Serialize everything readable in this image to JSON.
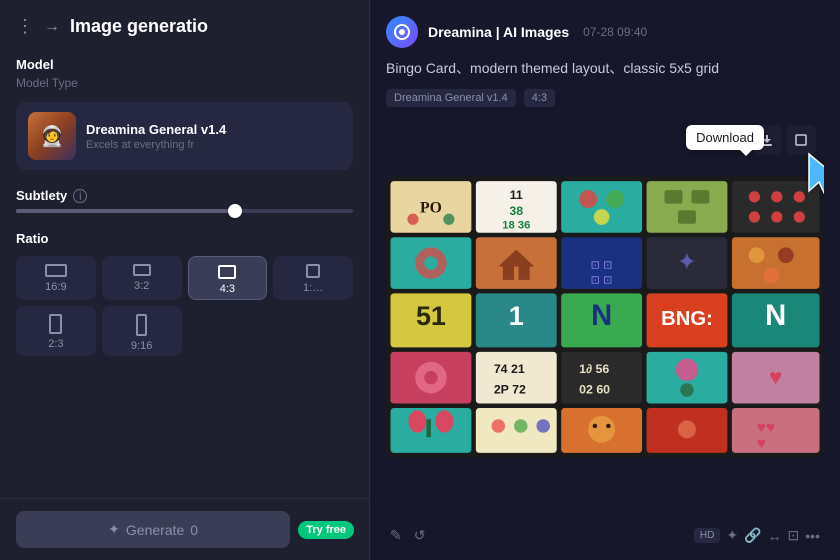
{
  "left": {
    "menu_icon": "⋮",
    "arrow": "→",
    "title": "Image generatio",
    "model_section": "Model",
    "model_type": "Model Type",
    "model_thumb_emoji": "🧑‍🚀",
    "model_name": "Dreamina General v1.4",
    "model_desc": "Excels at everything fr",
    "subtlety_label": "Subtlety",
    "ratio_label": "Ratio",
    "ratios_row1": [
      {
        "label": "16:9",
        "active": false
      },
      {
        "label": "3:2",
        "active": false
      },
      {
        "label": "4:3",
        "active": true
      },
      {
        "label": "1:…",
        "active": false
      }
    ],
    "ratios_row2": [
      {
        "label": "2:3",
        "active": false
      },
      {
        "label": "9:16",
        "active": false
      }
    ],
    "generate_label": "Generate",
    "generate_icon": "✦",
    "generate_count": "0",
    "try_free": "Try free"
  },
  "right": {
    "app_logo": "◎",
    "app_name": "Dreamina | AI Images",
    "timestamp": "07-28  09:40",
    "prompt": "Bingo Card、modern themed layout、classic 5x5 grid",
    "tag1": "Dreamina General v1.4",
    "tag2": "4:3",
    "download_tooltip": "Download",
    "action_buttons": {
      "hd": "HD",
      "icons": [
        "✎",
        "↺",
        "⬜",
        "↔",
        "⊡",
        "🔗",
        "•••"
      ]
    }
  }
}
